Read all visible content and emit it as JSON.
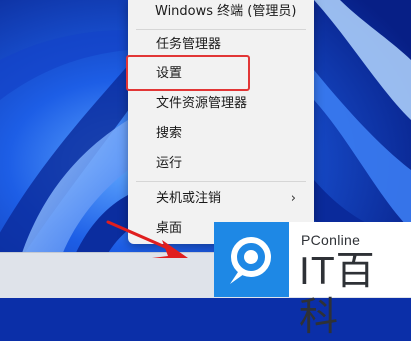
{
  "context_menu": {
    "items": [
      {
        "label": "Windows 终端 (管理员)"
      },
      {
        "label": "任务管理器"
      },
      {
        "label": "设置"
      },
      {
        "label": "文件资源管理器"
      },
      {
        "label": "搜索"
      },
      {
        "label": "运行"
      },
      {
        "label": "关机或注销",
        "submenu_icon": "chevron-right-icon"
      },
      {
        "label": "桌面"
      }
    ],
    "highlighted_item": "设置"
  },
  "watermark": {
    "brand": "PConline",
    "name": "IT百科"
  },
  "colors": {
    "highlight_border": "#e23636",
    "arrow": "#e01e1e",
    "logo_blue": "#1e88e5",
    "menu_bg": "#f2f2f2"
  }
}
